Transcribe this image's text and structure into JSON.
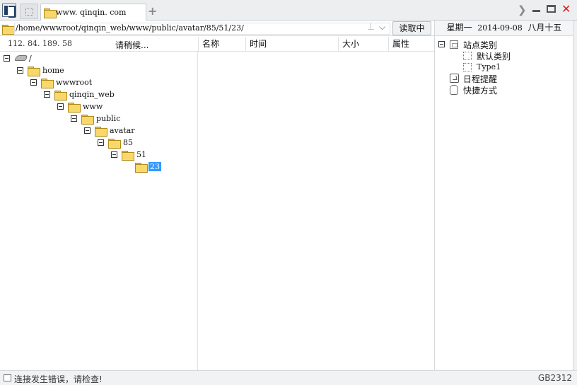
{
  "tabs": {
    "active_label": "www. qinqin. com"
  },
  "address": {
    "path": "/home/wwwroot/qinqin_web/www/public/avatar/85/51/23/",
    "pin_icon": "pin-icon",
    "read_button": "读取中"
  },
  "header": {
    "ip": "112. 84. 189. 58",
    "status": "请稍候...",
    "columns": [
      "名称",
      "时间",
      "大小",
      "属性"
    ]
  },
  "tree": [
    {
      "label": "/",
      "icon": "drive-icon"
    },
    {
      "label": "home",
      "icon": "folder-icon"
    },
    {
      "label": "wwwroot",
      "icon": "folder-icon"
    },
    {
      "label": "qinqin_web",
      "icon": "folder-icon"
    },
    {
      "label": "www",
      "icon": "folder-icon"
    },
    {
      "label": "public",
      "icon": "folder-icon"
    },
    {
      "label": "avatar",
      "icon": "folder-icon"
    },
    {
      "label": "85",
      "icon": "folder-icon"
    },
    {
      "label": "51",
      "icon": "folder-icon"
    },
    {
      "label": "23",
      "icon": "folder-open-icon",
      "selected": true
    }
  ],
  "right_panel": {
    "weekday": "星期一",
    "date": "2014-09-08",
    "lunar": "八月十五",
    "items": [
      {
        "label": "站点类别"
      },
      {
        "label": "默认类别"
      },
      {
        "label": "Type1"
      },
      {
        "label": "日程提醒"
      },
      {
        "label": "快捷方式"
      }
    ]
  },
  "status": {
    "message": "连接发生错误，请检查!",
    "encoding": "GB2312"
  },
  "colors": {
    "selection": "#3399ff",
    "close": "#d92020",
    "folder": "#f8d86a"
  }
}
